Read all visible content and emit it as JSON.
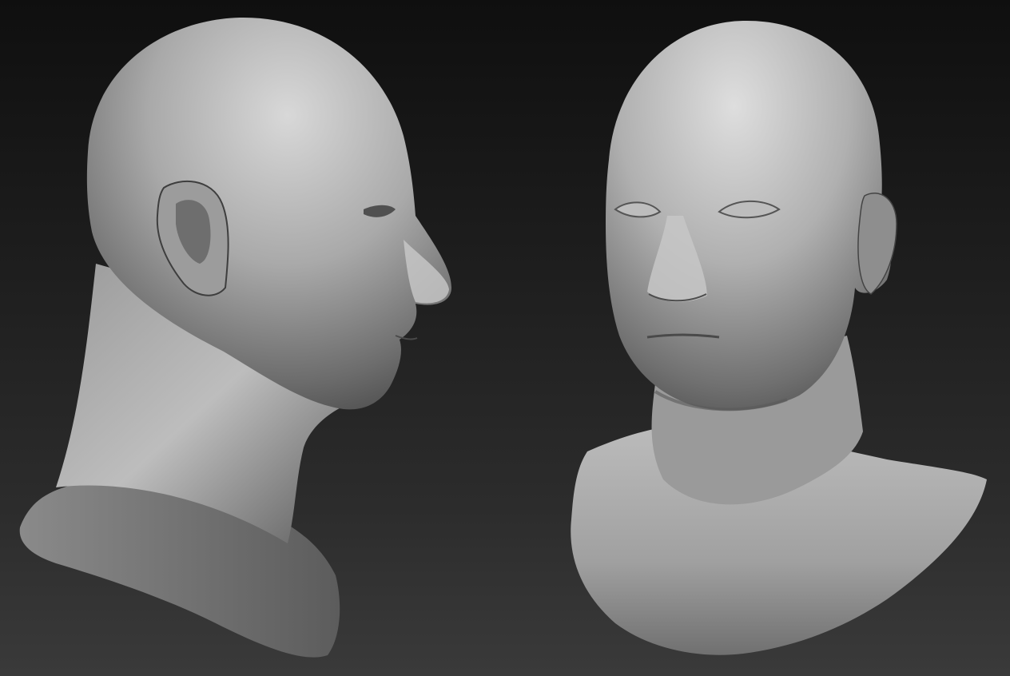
{
  "viewport": {
    "models": [
      {
        "view": "side-profile",
        "subject": "bust"
      },
      {
        "view": "three-quarter",
        "subject": "bust"
      }
    ]
  }
}
